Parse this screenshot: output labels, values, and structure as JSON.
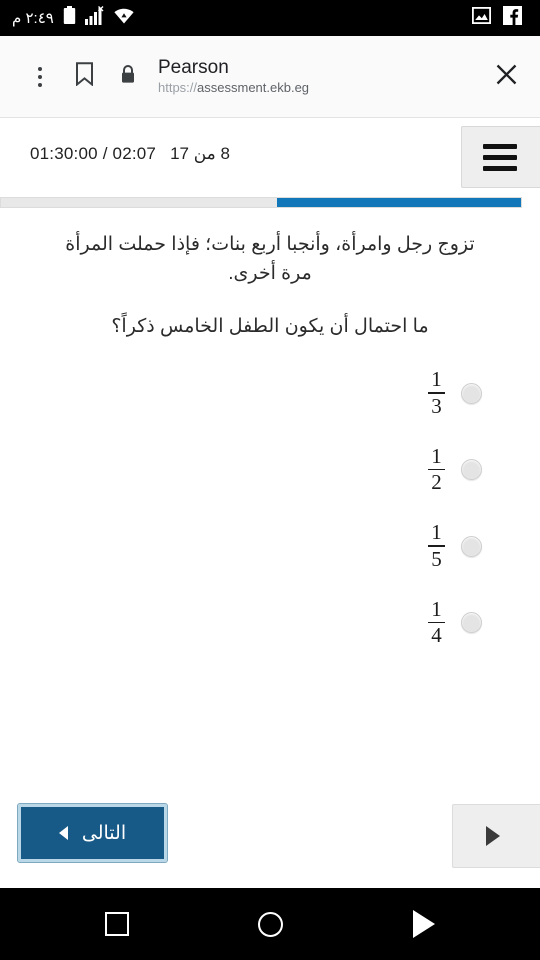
{
  "status_bar": {
    "clock": "٢:٤٩ م",
    "icons_left": [
      "battery-icon",
      "signal-bars-icon",
      "wifi-icon"
    ],
    "icons_right": [
      "screenshot-icon",
      "facebook-icon"
    ]
  },
  "browser_bar": {
    "menu_icon": "overflow-menu-icon",
    "bookmark_icon": "bookmark-icon",
    "lock_icon": "lock-icon",
    "title": "Pearson",
    "url_scheme": "https://",
    "url_host": "assessment.ekb.eg",
    "close_icon": "close-icon"
  },
  "exam_header": {
    "timer": "01:30:00 / 02:07",
    "question_counter": "8 من 17",
    "menu_button_icon": "hamburger-menu-icon",
    "progress_percent": 47,
    "progress_fill_color": "#1277b8",
    "progress_track_color": "#e8e8e8"
  },
  "question": {
    "stem": "تزوج رجل وامرأة، وأنجبا أربع بنات؛ فإذا حملت المرأة مرة أخرى.",
    "prompt": "ما احتمال أن يكون الطفل الخامس ذكراً؟",
    "options": [
      {
        "numerator": "1",
        "denominator": "3",
        "selected": false
      },
      {
        "numerator": "1",
        "denominator": "2",
        "selected": false
      },
      {
        "numerator": "1",
        "denominator": "5",
        "selected": false
      },
      {
        "numerator": "1",
        "denominator": "4",
        "selected": false
      }
    ]
  },
  "footer": {
    "next_label": "التالى",
    "next_icon": "triangle-left-icon",
    "next_color": "#185a87",
    "prev_icon": "triangle-right-icon"
  },
  "nav_bar": {
    "recents_icon": "square-recents-icon",
    "home_icon": "circle-home-icon",
    "back_icon": "triangle-back-icon"
  }
}
